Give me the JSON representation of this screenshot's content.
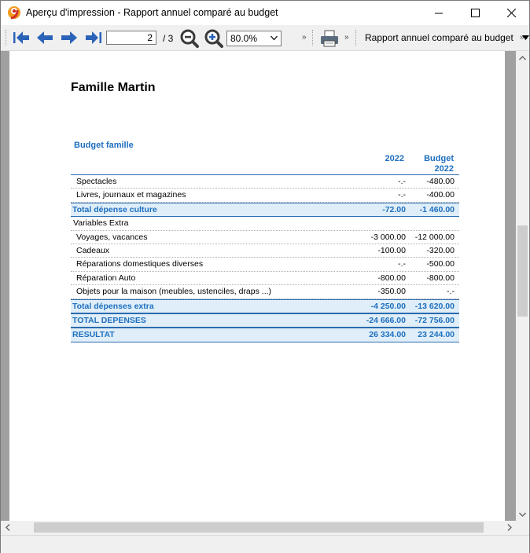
{
  "window": {
    "title": "Aperçu d'impression - Rapport annuel comparé au budget"
  },
  "toolbar": {
    "page_current": "2",
    "page_total": "/ 3",
    "zoom": "80.0%",
    "overflow": "»",
    "report_selector": "Rapport annuel comparé au budget"
  },
  "report": {
    "title": "Famille Martin",
    "section": "Budget famille",
    "col1": "2022",
    "col2_line1": "Budget",
    "col2_line2": "2022",
    "rows": [
      {
        "label": "Spectacles",
        "v1": "-.-",
        "v2": "-480.00",
        "kind": "item"
      },
      {
        "label": "Livres, journaux et magazines",
        "v1": "-.-",
        "v2": "-400.00",
        "kind": "item"
      },
      {
        "label": "Total dépense culture",
        "v1": "-72.00",
        "v2": "-1 460.00",
        "kind": "total"
      },
      {
        "label": "Variables Extra",
        "v1": "",
        "v2": "",
        "kind": "group"
      },
      {
        "label": "Voyages, vacances",
        "v1": "-3 000.00",
        "v2": "-12 000.00",
        "kind": "item"
      },
      {
        "label": "Cadeaux",
        "v1": "-100.00",
        "v2": "-320.00",
        "kind": "item"
      },
      {
        "label": "Réparations domestiques diverses",
        "v1": "-.-",
        "v2": "-500.00",
        "kind": "item"
      },
      {
        "label": "Réparation Auto",
        "v1": "-800.00",
        "v2": "-800.00",
        "kind": "item"
      },
      {
        "label": "Objets pour la maison (meubles, ustenciles, draps ...)",
        "v1": "-350.00",
        "v2": "-.-",
        "kind": "item"
      },
      {
        "label": "Total dépenses extra",
        "v1": "-4 250.00",
        "v2": "-13 620.00",
        "kind": "total"
      },
      {
        "label": "TOTAL DEPENSES",
        "v1": "-24 666.00",
        "v2": "-72 756.00",
        "kind": "total"
      },
      {
        "label": "RESULTAT",
        "v1": "26 334.00",
        "v2": "23 244.00",
        "kind": "total"
      }
    ]
  },
  "colors": {
    "accent": "#1e6fc0",
    "total_bg": "#dfeef8",
    "page_bg": "#a0a0a0"
  }
}
